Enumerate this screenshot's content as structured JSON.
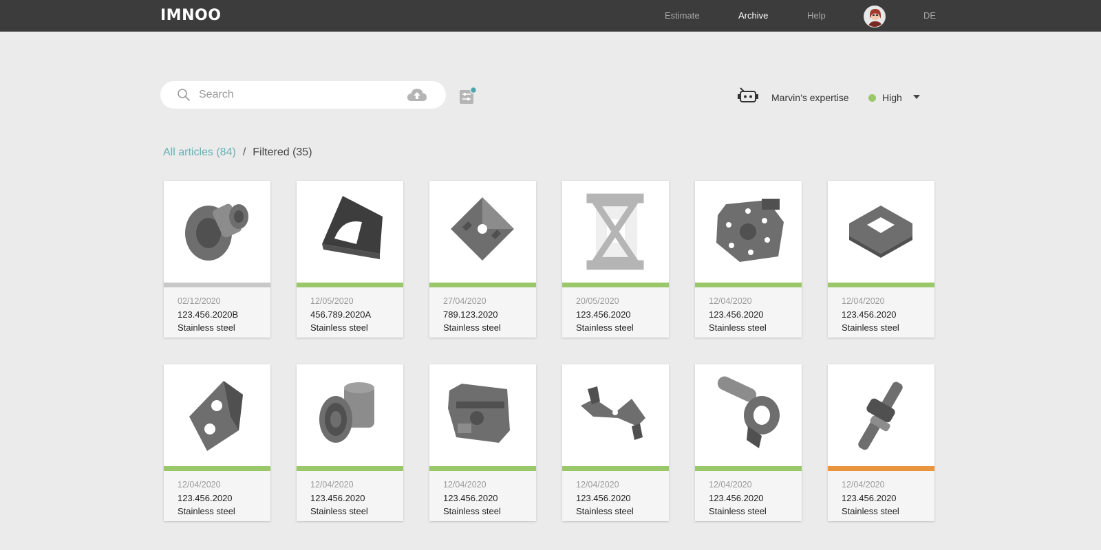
{
  "app": {
    "logo": "IMNOO",
    "nav": [
      {
        "label": "Estimate",
        "active": false
      },
      {
        "label": "Archive",
        "active": true
      },
      {
        "label": "Help",
        "active": false
      }
    ],
    "language": "DE"
  },
  "search": {
    "placeholder": "Search",
    "value": ""
  },
  "expertise": {
    "label": "Marvin’s expertise",
    "value": "High",
    "status_color": "#9bc76b"
  },
  "breadcrumb": {
    "all": "All articles (84)",
    "separator": "/",
    "current": "Filtered (35)"
  },
  "colors": {
    "accent": "#6ab0b4",
    "status_ok": "#9bc76b",
    "status_neutral": "#c8c8c8",
    "status_warning": "#e8953e",
    "topbar": "#3c3c3c"
  },
  "articles": [
    {
      "date": "02/12/2020",
      "id": "123.456.2020B",
      "material": "Stainless steel",
      "status": "neutral",
      "part": "flange-part"
    },
    {
      "date": "12/05/2020",
      "id": "456.789.2020A",
      "material": "Stainless steel",
      "status": "ok",
      "part": "bracket-part"
    },
    {
      "date": "27/04/2020",
      "id": "789.123.2020",
      "material": "Stainless steel",
      "status": "ok",
      "part": "plate-part"
    },
    {
      "date": "20/05/2020",
      "id": "123.456.2020",
      "material": "Stainless steel",
      "status": "ok",
      "part": "placeholder-part",
      "pending": true
    },
    {
      "date": "12/04/2020",
      "id": "123.456.2020",
      "material": "Stainless steel",
      "status": "ok",
      "part": "hub-part"
    },
    {
      "date": "12/04/2020",
      "id": "123.456.2020",
      "material": "Stainless steel",
      "status": "ok",
      "part": "frame-part"
    },
    {
      "date": "12/04/2020",
      "id": "123.456.2020",
      "material": "Stainless steel",
      "status": "ok",
      "part": "block-part"
    },
    {
      "date": "12/04/2020",
      "id": "123.456.2020",
      "material": "Stainless steel",
      "status": "ok",
      "part": "cylinder-part"
    },
    {
      "date": "12/04/2020",
      "id": "123.456.2020",
      "material": "Stainless steel",
      "status": "ok",
      "part": "housing-part"
    },
    {
      "date": "12/04/2020",
      "id": "123.456.2020",
      "material": "Stainless steel",
      "status": "ok",
      "part": "lever-part"
    },
    {
      "date": "12/04/2020",
      "id": "123.456.2020",
      "material": "Stainless steel",
      "status": "ok",
      "part": "arm-part"
    },
    {
      "date": "12/04/2020",
      "id": "123.456.2020",
      "material": "Stainless steel",
      "status": "warning",
      "part": "shaft-part"
    }
  ]
}
